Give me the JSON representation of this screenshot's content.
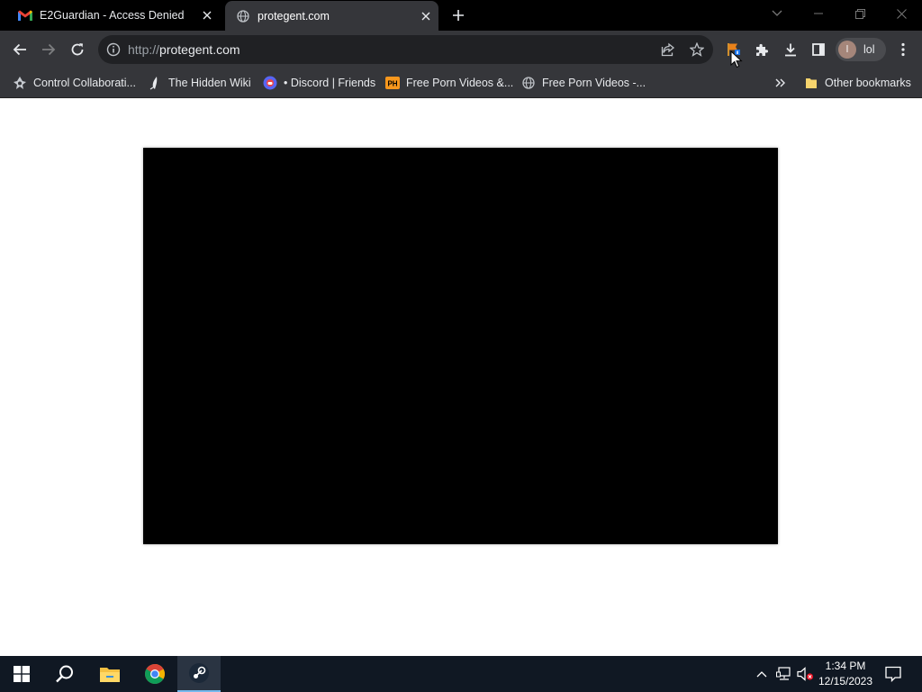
{
  "tabs": [
    {
      "title": "E2Guardian - Access Denied",
      "favicon": "gmail-icon",
      "active": false
    },
    {
      "title": "protegent.com",
      "favicon": "globe-icon",
      "active": true
    }
  ],
  "omnibox": {
    "scheme": "http://",
    "host": "protegent.com"
  },
  "profile": {
    "initial": "l",
    "name": "lol"
  },
  "bookmarks": {
    "items": [
      {
        "label": "Control Collaborati...",
        "icon": "control-icon"
      },
      {
        "label": "The Hidden Wiki",
        "icon": "wiki-icon"
      },
      {
        "label": "• Discord | Friends",
        "icon": "discord-icon"
      },
      {
        "label": "Free Porn Videos &...",
        "icon": "ph-icon"
      },
      {
        "label": "Free Porn Videos -...",
        "icon": "globe-icon"
      }
    ],
    "other": "Other bookmarks",
    "ph_badge": "PH"
  },
  "clock": {
    "time": "1:34 PM",
    "date": "12/15/2023"
  },
  "colors": {
    "tab_bg": "#000000",
    "toolbar_bg": "#35363a",
    "omnibox_bg": "#202124",
    "taskbar_bg": "#101823",
    "accent": "#76b9ed"
  }
}
